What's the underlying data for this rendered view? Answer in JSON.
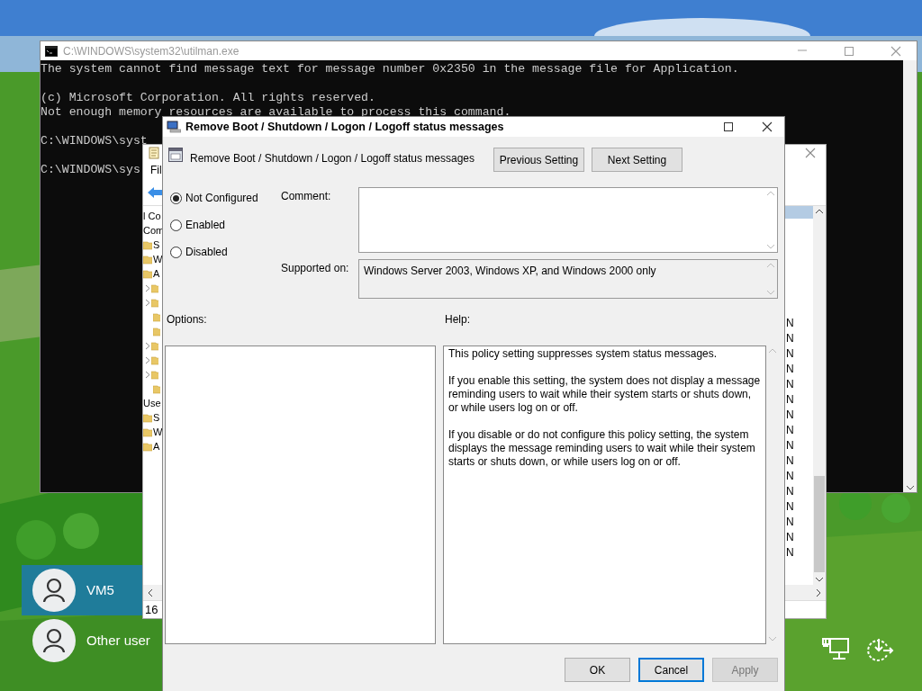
{
  "console": {
    "title": "C:\\WINDOWS\\system32\\utilman.exe",
    "blocks": [
      [
        "The system cannot find message text for message number 0x2350 in the message file for Application."
      ],
      [
        "(c) Microsoft Corporation. All rights reserved.",
        "Not enough memory resources are available to process this command."
      ],
      [
        "C:\\WINDOWS\\syst"
      ],
      [
        "C:\\WINDOWS\\sys"
      ]
    ]
  },
  "editor_window": {
    "menu_fragment": "Fil",
    "tree_fragments": [
      {
        "text": "l Co",
        "kind": "text"
      },
      {
        "text": "Com",
        "kind": "text"
      },
      {
        "text": "S",
        "kind": "folder"
      },
      {
        "text": "W",
        "kind": "folder"
      },
      {
        "text": "A",
        "kind": "folder"
      },
      {
        "kind": "expander"
      },
      {
        "kind": "expander"
      },
      {
        "kind": "plain"
      },
      {
        "kind": "plain"
      },
      {
        "kind": "expander"
      },
      {
        "kind": "expander"
      },
      {
        "kind": "expander"
      },
      {
        "kind": "plain"
      },
      {
        "text": "Use",
        "kind": "text"
      },
      {
        "text": "S",
        "kind": "folder"
      },
      {
        "text": "W",
        "kind": "folder"
      },
      {
        "text": "A",
        "kind": "folder"
      }
    ],
    "column_fragments": [
      "N",
      "N",
      "N",
      "N",
      "N",
      "N",
      "N",
      "N",
      "N",
      "N",
      "N",
      "N",
      "N",
      "N",
      "N",
      "N"
    ],
    "status_fragment": "16"
  },
  "dialog": {
    "title": "Remove Boot / Shutdown / Logon / Logoff status messages",
    "setting_name": "Remove Boot / Shutdown / Logon / Logoff status messages",
    "nav_buttons": [
      "Previous Setting",
      "Next Setting"
    ],
    "states": [
      {
        "label": "Not Configured",
        "selected": true
      },
      {
        "label": "Enabled",
        "selected": false
      },
      {
        "label": "Disabled",
        "selected": false
      }
    ],
    "comment_label": "Comment:",
    "supported_label": "Supported on:",
    "supported_on": "Windows Server 2003, Windows XP, and Windows 2000 only",
    "options_label": "Options:",
    "help_label": "Help:",
    "help": [
      "This policy setting suppresses system status messages.",
      "If you enable this setting, the system does not display a message reminding users to wait while their system starts or shuts down, or while users log on or off.",
      "If you disable or do not configure this policy setting, the system displays the message reminding users to wait while their system starts or shuts down, or while users log on or off."
    ],
    "buttons": [
      {
        "label": "OK",
        "default": false,
        "disabled": false
      },
      {
        "label": "Cancel",
        "default": true,
        "disabled": false
      },
      {
        "label": "Apply",
        "default": false,
        "disabled": true
      }
    ]
  },
  "users": [
    {
      "name": "VM5",
      "selected": true
    },
    {
      "name": "Other user",
      "selected": false
    }
  ]
}
